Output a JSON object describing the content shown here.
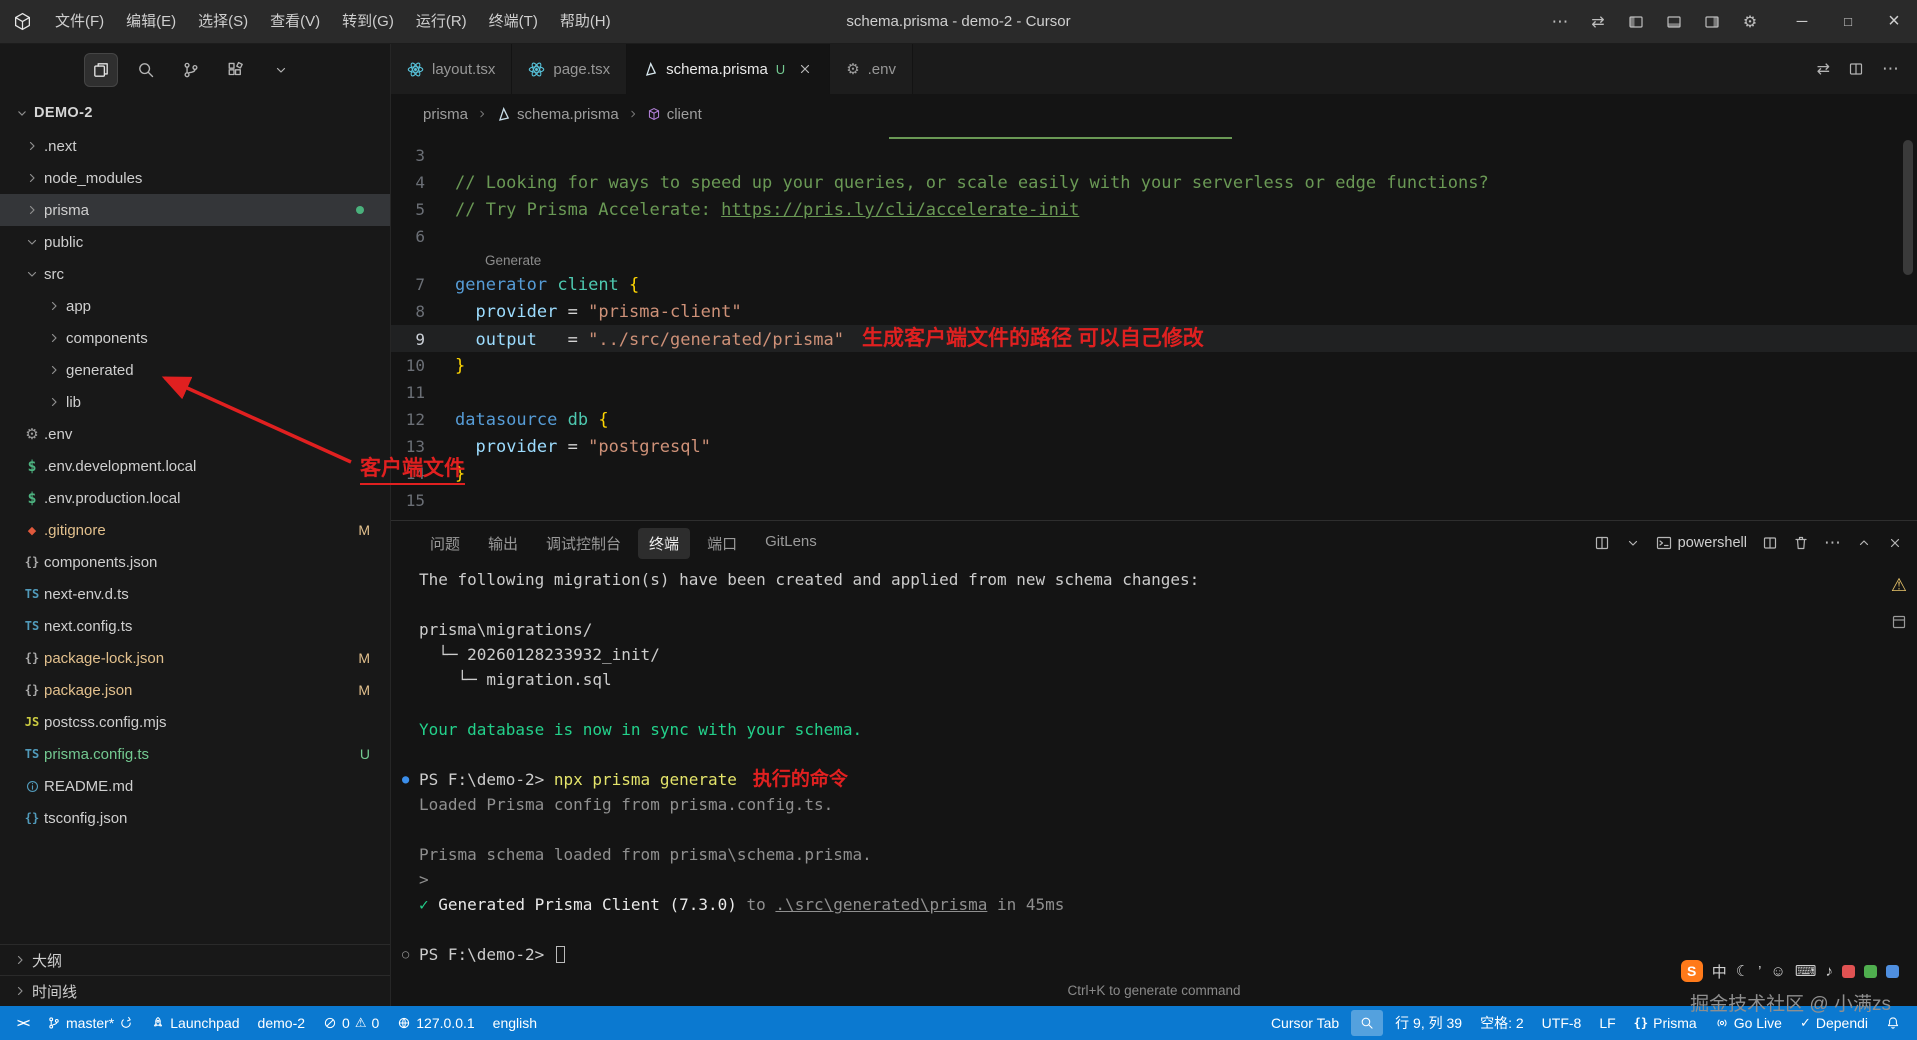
{
  "titlebar": {
    "menus": [
      "文件(F)",
      "编辑(E)",
      "选择(S)",
      "查看(V)",
      "转到(G)",
      "运行(R)",
      "终端(T)",
      "帮助(H)"
    ],
    "title": "schema.prisma - demo-2 - Cursor",
    "actions": [
      "more",
      "compare",
      "layout-left",
      "layout-bottom",
      "layout-right",
      "settings"
    ],
    "window_controls": [
      "minimize",
      "maximize",
      "close"
    ]
  },
  "activity": [
    {
      "icon": "files",
      "active": true
    },
    {
      "icon": "search"
    },
    {
      "icon": "source-control"
    },
    {
      "icon": "extensions"
    },
    {
      "icon": "chevron-down"
    }
  ],
  "explorer": {
    "root": "DEMO-2",
    "items": [
      {
        "label": ".next",
        "kind": "folder"
      },
      {
        "label": "node_modules",
        "kind": "folder"
      },
      {
        "label": "prisma",
        "kind": "folder",
        "selected": true,
        "dot": true
      },
      {
        "label": "public",
        "kind": "folder",
        "expanded": true
      },
      {
        "label": "src",
        "kind": "folder",
        "expanded": true
      },
      {
        "label": "app",
        "kind": "folder",
        "indent": 1
      },
      {
        "label": "components",
        "kind": "folder",
        "indent": 1
      },
      {
        "label": "generated",
        "kind": "folder",
        "indent": 1
      },
      {
        "label": "lib",
        "kind": "folder",
        "indent": 1
      },
      {
        "label": ".env",
        "kind": "file",
        "icon": "gear"
      },
      {
        "label": ".env.development.local",
        "kind": "file",
        "icon": "dollar"
      },
      {
        "label": ".env.production.local",
        "kind": "file",
        "icon": "dollar"
      },
      {
        "label": ".gitignore",
        "kind": "file",
        "icon": "git-file",
        "badge": "M"
      },
      {
        "label": "components.json",
        "kind": "file",
        "icon": "braces"
      },
      {
        "label": "next-env.d.ts",
        "kind": "file",
        "icon": "ts"
      },
      {
        "label": "next.config.ts",
        "kind": "file",
        "icon": "ts"
      },
      {
        "label": "package-lock.json",
        "kind": "file",
        "icon": "braces",
        "badge": "M"
      },
      {
        "label": "package.json",
        "kind": "file",
        "icon": "braces",
        "badge": "M"
      },
      {
        "label": "postcss.config.mjs",
        "kind": "file",
        "icon": "js"
      },
      {
        "label": "prisma.config.ts",
        "kind": "file",
        "icon": "ts",
        "badge": "U"
      },
      {
        "label": "README.md",
        "kind": "file",
        "icon": "info"
      },
      {
        "label": "tsconfig.json",
        "kind": "file",
        "icon": "braces-blue"
      }
    ],
    "bottom_sections": [
      "大纲",
      "时间线"
    ]
  },
  "tabs": [
    {
      "label": "layout.tsx",
      "icon": "react"
    },
    {
      "label": "page.tsx",
      "icon": "react"
    },
    {
      "label": "schema.prisma",
      "icon": "prisma",
      "modifier": "U",
      "active": true,
      "closable": true
    },
    {
      "label": ".env",
      "icon": "gear"
    }
  ],
  "tab_actions": [
    "compare",
    "split-editor",
    "more"
  ],
  "breadcrumb": [
    {
      "label": "prisma"
    },
    {
      "label": "schema.prisma",
      "icon": "prisma"
    },
    {
      "label": "client",
      "icon": "symbol-cube"
    }
  ],
  "editor": {
    "lines": [
      {
        "n": "3",
        "segs": []
      },
      {
        "n": "4",
        "segs": [
          {
            "s": "cm",
            "t": "// Looking for ways to speed up your queries, or scale easily with your serverless or edge functions?"
          }
        ]
      },
      {
        "n": "5",
        "segs": [
          {
            "s": "cm",
            "t": "// Try Prisma Accelerate: "
          },
          {
            "s": "link",
            "t": "https://pris.ly/cli/accelerate-init"
          }
        ]
      },
      {
        "n": "6",
        "segs": []
      },
      {
        "lens": "Generate"
      },
      {
        "n": "7",
        "segs": [
          {
            "s": "kw",
            "t": "generator"
          },
          {
            "s": "txt",
            "t": " "
          },
          {
            "s": "type",
            "t": "client"
          },
          {
            "s": "txt",
            "t": " "
          },
          {
            "s": "br",
            "t": "{"
          }
        ]
      },
      {
        "n": "8",
        "segs": [
          {
            "s": "txt",
            "t": "  "
          },
          {
            "s": "prop",
            "t": "provider"
          },
          {
            "s": "txt",
            "t": " = "
          },
          {
            "s": "str",
            "t": "\"prisma-client\""
          }
        ]
      },
      {
        "n": "9",
        "current": true,
        "segs": [
          {
            "s": "txt",
            "t": "  "
          },
          {
            "s": "prop",
            "t": "output"
          },
          {
            "s": "txt",
            "t": "   = "
          },
          {
            "s": "str",
            "t": "\"../src/generated/prisma\""
          },
          {
            "s": "annot",
            "t": "生成客户端文件的路径 可以自己修改"
          }
        ]
      },
      {
        "n": "10",
        "segs": [
          {
            "s": "br",
            "t": "}"
          }
        ]
      },
      {
        "n": "11",
        "segs": []
      },
      {
        "n": "12",
        "segs": [
          {
            "s": "kw",
            "t": "datasource"
          },
          {
            "s": "txt",
            "t": " "
          },
          {
            "s": "type",
            "t": "db"
          },
          {
            "s": "txt",
            "t": " "
          },
          {
            "s": "br",
            "t": "{"
          }
        ]
      },
      {
        "n": "13",
        "segs": [
          {
            "s": "txt",
            "t": "  "
          },
          {
            "s": "prop",
            "t": "provider"
          },
          {
            "s": "txt",
            "t": " = "
          },
          {
            "s": "str",
            "t": "\"postgresql\""
          }
        ]
      },
      {
        "n": "14",
        "segs": [
          {
            "s": "br",
            "t": "}"
          }
        ]
      },
      {
        "n": "15",
        "segs": []
      }
    ]
  },
  "panel": {
    "tabs": [
      {
        "label": "问题"
      },
      {
        "label": "输出"
      },
      {
        "label": "调试控制台"
      },
      {
        "label": "终端",
        "active": true
      },
      {
        "label": "端口"
      },
      {
        "label": "GitLens"
      }
    ],
    "actions": [
      {
        "i": "grid"
      },
      {
        "i": "chevron-down"
      },
      {
        "i": "terminal",
        "t": "powershell"
      },
      {
        "i": "split-editor"
      },
      {
        "i": "trash"
      },
      {
        "i": "more"
      },
      {
        "i": "chevron-up"
      },
      {
        "i": "close"
      }
    ],
    "hint": "Ctrl+K to generate command"
  },
  "terminal": {
    "lines": [
      {
        "segs": [
          {
            "s": "txt",
            "t": "The following migration(s) have been created and applied from new schema changes:"
          }
        ]
      },
      {
        "segs": []
      },
      {
        "segs": [
          {
            "s": "txt",
            "t": "prisma\\migrations/"
          }
        ]
      },
      {
        "segs": [
          {
            "s": "txt",
            "t": "  └─ 20260128233932_init/"
          }
        ]
      },
      {
        "segs": [
          {
            "s": "txt",
            "t": "    └─ migration.sql"
          }
        ]
      },
      {
        "segs": []
      },
      {
        "segs": [
          {
            "s": "grn",
            "t": "Your database is now in sync with your schema."
          }
        ]
      },
      {
        "segs": []
      },
      {
        "g": "●",
        "gc": "blue",
        "segs": [
          {
            "s": "txt",
            "t": "PS F:\\demo-2> "
          },
          {
            "s": "cmd",
            "t": "npx prisma generate"
          },
          {
            "s": "annot",
            "t": "执行的命令"
          }
        ]
      },
      {
        "segs": [
          {
            "s": "dim",
            "t": "Loaded Prisma config from prisma.config.ts."
          }
        ]
      },
      {
        "segs": []
      },
      {
        "segs": [
          {
            "s": "dim",
            "t": "Prisma schema loaded from prisma\\schema.prisma."
          }
        ]
      },
      {
        "segs": [
          {
            "s": "dim",
            "t": ">"
          }
        ]
      },
      {
        "segs": [
          {
            "s": "grn",
            "t": "✓"
          },
          {
            "s": "wht",
            "t": " Generated Prisma Client (7.3.0)"
          },
          {
            "s": "dim",
            "t": " to "
          },
          {
            "s": "dimu",
            "t": ".\\src\\generated\\prisma"
          },
          {
            "s": "dim",
            "t": " in 45ms"
          }
        ]
      },
      {
        "segs": []
      },
      {
        "g": "○",
        "gc": "gray",
        "segs": [
          {
            "s": "txt",
            "t": "PS F:\\demo-2> "
          },
          {
            "s": "cursor",
            "t": ""
          }
        ]
      }
    ]
  },
  "statusbar": {
    "left": [
      {
        "name": "remote-indicator",
        "toks": [
          {
            "i": "remote"
          }
        ]
      },
      {
        "name": "git-branch",
        "toks": [
          {
            "i": "branch"
          },
          {
            "t": "master*"
          },
          {
            "i": "sync"
          }
        ]
      },
      {
        "name": "launchpad",
        "toks": [
          {
            "i": "rocket"
          },
          {
            "t": "Launchpad"
          }
        ]
      },
      {
        "name": "project",
        "toks": [
          {
            "t": "demo-2"
          }
        ]
      },
      {
        "name": "problems",
        "toks": [
          {
            "i": "error"
          },
          {
            "t": "0"
          },
          {
            "i": "warning"
          },
          {
            "t": "0"
          }
        ]
      },
      {
        "name": "host",
        "toks": [
          {
            "i": "globe"
          },
          {
            "t": "127.0.0.1"
          }
        ]
      },
      {
        "name": "language",
        "toks": [
          {
            "t": "english"
          }
        ]
      }
    ],
    "right": [
      {
        "name": "cursor-tab",
        "toks": [
          {
            "t": "Cursor Tab"
          }
        ]
      },
      {
        "name": "search",
        "hl": true,
        "toks": [
          {
            "i": "search"
          }
        ]
      },
      {
        "name": "cursor-position",
        "toks": [
          {
            "t": "行 9, 列 39"
          }
        ]
      },
      {
        "name": "indentation",
        "toks": [
          {
            "t": "空格: 2"
          }
        ]
      },
      {
        "name": "encoding",
        "toks": [
          {
            "t": "UTF-8"
          }
        ]
      },
      {
        "name": "eol",
        "toks": [
          {
            "t": "LF"
          }
        ]
      },
      {
        "name": "language-mode",
        "toks": [
          {
            "i": "braces"
          },
          {
            "t": "Prisma"
          }
        ]
      },
      {
        "name": "go-live",
        "toks": [
          {
            "i": "golive"
          },
          {
            "t": "Go Live"
          }
        ]
      },
      {
        "name": "dependi",
        "toks": [
          {
            "i": "check"
          },
          {
            "t": "Dependi"
          }
        ]
      },
      {
        "name": "notifications",
        "toks": [
          {
            "i": "bell"
          }
        ]
      }
    ]
  },
  "annotations": {
    "client_file": "客户端文件",
    "path_note": "生成客户端文件的路径 可以自己修改",
    "command_note": "执行的命令",
    "color": "#e02020"
  },
  "watermark": "掘金技术社区 @ 小满zs",
  "ime": {
    "glyphs": [
      "中",
      "☾",
      "’",
      "☺",
      "⌨",
      "♪"
    ]
  },
  "colors": {
    "statusbar": "#0b79d0",
    "annotation": "#e02020",
    "terminal_green": "#23d18b",
    "modified": "#e2c08d",
    "untracked": "#73c991"
  }
}
